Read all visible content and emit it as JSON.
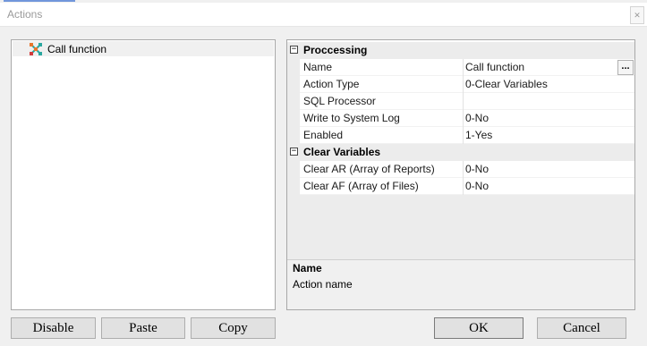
{
  "window": {
    "title": "Actions"
  },
  "tree": {
    "items": [
      {
        "label": "Call function",
        "icon": "function-node-icon"
      }
    ]
  },
  "properties": {
    "categories": [
      {
        "label": "Proccessing",
        "toggle": "⊟",
        "rows": [
          {
            "name": "Name",
            "value": "Call function",
            "has_ellipsis": true
          },
          {
            "name": "Action Type",
            "value": "0-Clear Variables"
          },
          {
            "name": "SQL Processor",
            "value": ""
          },
          {
            "name": "Write to System Log",
            "value": "0-No"
          },
          {
            "name": "Enabled",
            "value": "1-Yes"
          }
        ]
      },
      {
        "label": "Clear Variables",
        "toggle": "⊟",
        "rows": [
          {
            "name": "Clear AR (Array of Reports)",
            "value": "0-No"
          },
          {
            "name": "Clear AF (Array of Files)",
            "value": "0-No"
          }
        ]
      }
    ],
    "ellipsis_label": "...",
    "help": {
      "title": "Name",
      "description": "Action name"
    }
  },
  "buttons": {
    "disable": "Disable",
    "paste": "Paste",
    "copy": "Copy",
    "ok": "OK",
    "cancel": "Cancel"
  },
  "colors": {
    "panel_bg": "#f0f0f0",
    "category_bg": "#ececec",
    "border": "#a8a8a8",
    "icon_teal": "#2aa8a0",
    "icon_orange": "#e8762c",
    "icon_red": "#d33b3b"
  }
}
